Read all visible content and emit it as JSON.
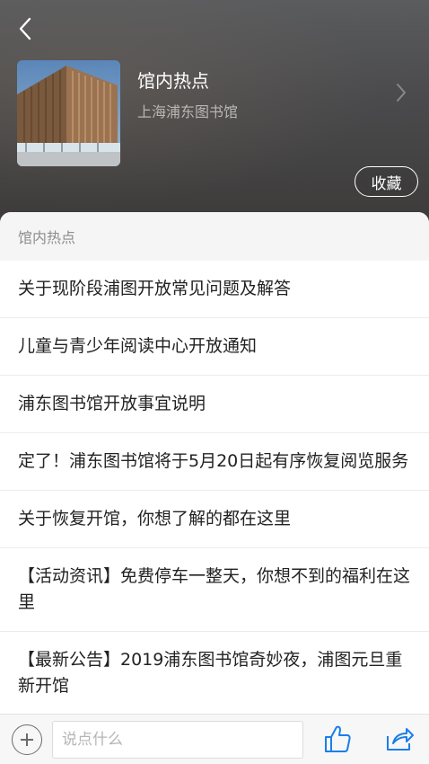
{
  "header": {
    "title": "馆内热点",
    "subtitle": "上海浦东图书馆",
    "favorite_label": "收藏",
    "back_icon": "chevron-left-icon",
    "detail_icon": "chevron-right-icon",
    "thumbnail": "library-building-photo"
  },
  "section": {
    "title": "馆内热点"
  },
  "items": [
    {
      "title": "关于现阶段浦图开放常见问题及解答"
    },
    {
      "title": "儿童与青少年阅读中心开放通知"
    },
    {
      "title": "浦东图书馆开放事宜说明"
    },
    {
      "title": "定了！浦东图书馆将于5月20日起有序恢复阅览服务"
    },
    {
      "title": "关于恢复开馆，你想了解的都在这里"
    },
    {
      "title": "【活动资讯】免费停车一整天，你想不到的福利在这里"
    },
    {
      "title": "【最新公告】2019浦东图书馆奇妙夜，浦图元旦重新开馆"
    }
  ],
  "bottom_bar": {
    "comment_placeholder": "说点什么",
    "add_icon": "plus-circle-icon",
    "like_icon": "thumbs-up-icon",
    "share_icon": "share-icon"
  },
  "colors": {
    "accent_blue": "#1a7fe8",
    "header_bg": "#4a4a4c",
    "section_bg": "#f5f5f5"
  }
}
